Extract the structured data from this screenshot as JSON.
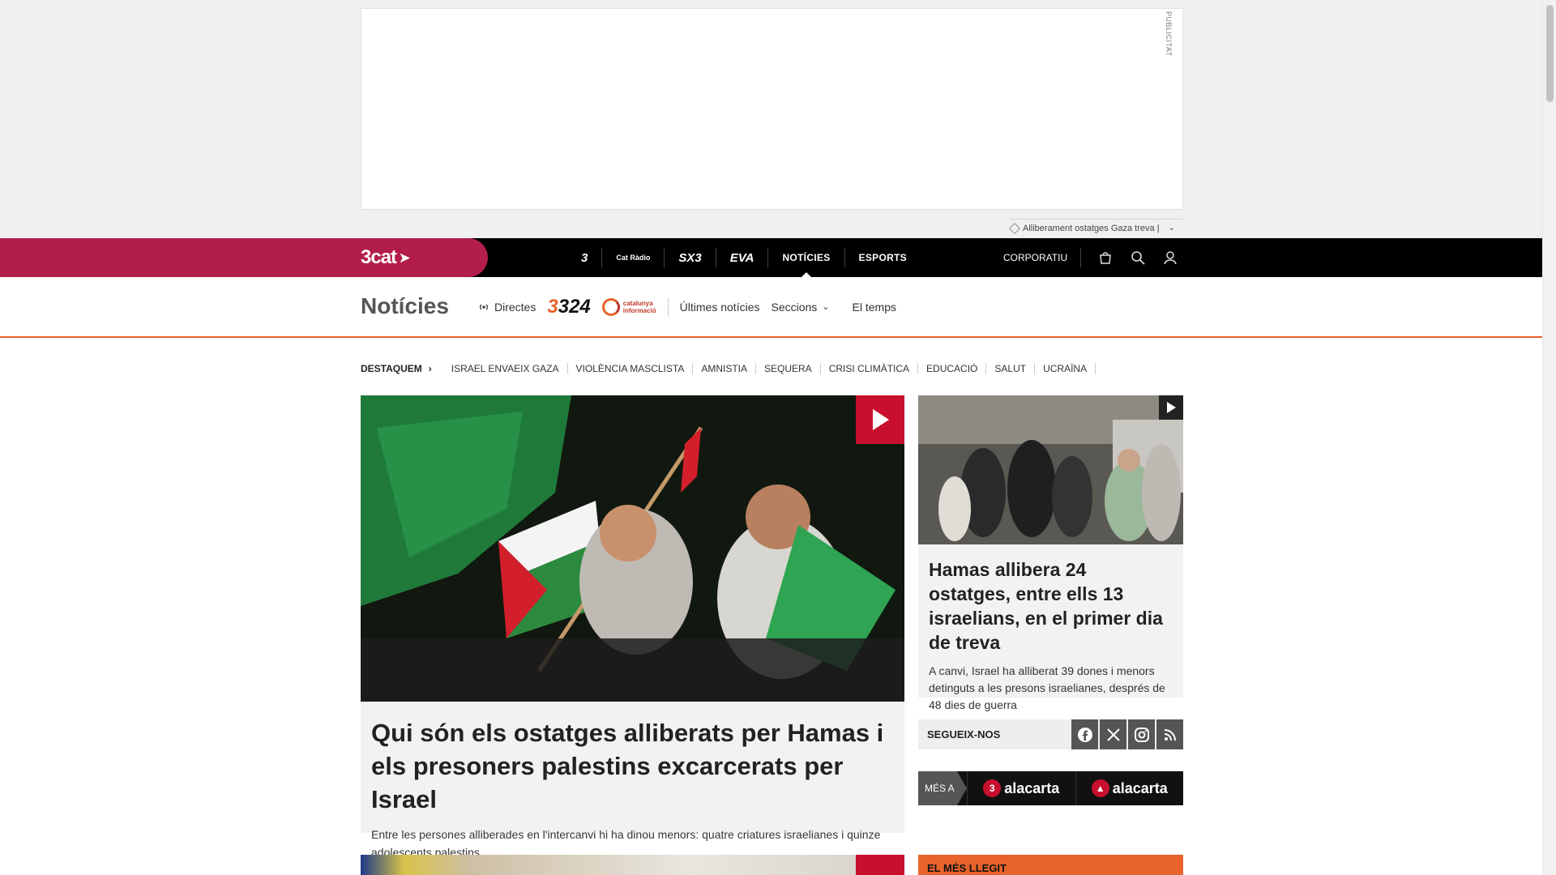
{
  "ad": {
    "label": "PUBLICITAT",
    "ticker_text": "Alliberament ostatges Gaza treva |"
  },
  "topnav": {
    "brand": "3cat",
    "channels": [
      "3",
      "Cat Ràdio",
      "SX3",
      "EVA"
    ],
    "sections": [
      "NOTÍCIES",
      "ESPORTS"
    ],
    "corporate": "CORPORATIU",
    "icons": [
      "shop-icon",
      "search-icon",
      "user-icon"
    ]
  },
  "section": {
    "title": "Notícies",
    "directes": "Directes",
    "logo_324": "324",
    "logo_ci_line1": "catalunya",
    "logo_ci_line2": "informació",
    "links": [
      "Últimes notícies",
      "Seccions",
      "El temps"
    ]
  },
  "tags": {
    "label": "DESTAQUEM",
    "items": [
      "ISRAEL ENVAEIX GAZA",
      "VIOLÈNCIA MASCLISTA",
      "AMNISTIA",
      "SEQUERA",
      "CRISI CLIMÀTICA",
      "EDUCACIÓ",
      "SALUT",
      "UCRAÏNA"
    ]
  },
  "main_story": {
    "title": "Qui són els ostatges alliberats per Hamas i els presoners palestins excarcerats per Israel",
    "summary": "Entre les persones alliberades en l'intercanvi hi ha dinou menors: quatre criatures israelianes i quinze adolescents palestins"
  },
  "side_story": {
    "title": "Hamas allibera 24 ostatges, entre ells 13 israelians, en el primer dia de treva",
    "summary": "A canvi, Israel ha alliberat 39 dones i menors detinguts a les presons israelianes, després de 48 dies de guerra"
  },
  "social": {
    "label": "SEGUEIX-NOS",
    "networks": [
      "facebook-icon",
      "x-icon",
      "instagram-icon",
      "rss-icon"
    ]
  },
  "alacarta": {
    "label": "MÉS A",
    "items": [
      "alacarta",
      "alacarta"
    ]
  },
  "mes_llegit": {
    "label": "EL MÉS LLEGIT"
  },
  "colors": {
    "brand": "#b31d4a",
    "accent": "#e8632b",
    "play_red": "#c8102e"
  }
}
